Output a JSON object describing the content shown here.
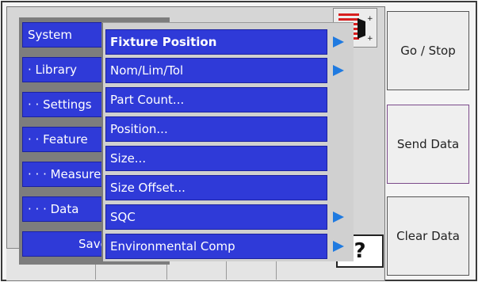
{
  "menu_level1": {
    "items": [
      {
        "label": "System"
      },
      {
        "label": "· Library"
      },
      {
        "label": "· · Settings"
      },
      {
        "label": "· · Feature"
      },
      {
        "label": "· · · Measurements"
      },
      {
        "label": "· · · Data"
      },
      {
        "label": "Save"
      }
    ]
  },
  "menu_level2": {
    "items": [
      {
        "label": "Fixture Position",
        "has_submenu": true
      },
      {
        "label": "Nom/Lim/Tol",
        "has_submenu": true
      },
      {
        "label": "Part Count...",
        "has_submenu": false
      },
      {
        "label": "Position...",
        "has_submenu": false
      },
      {
        "label": "Size...",
        "has_submenu": false
      },
      {
        "label": "Size Offset...",
        "has_submenu": false
      },
      {
        "label": "SQC",
        "has_submenu": true
      },
      {
        "label": "Environmental Comp",
        "has_submenu": true
      }
    ]
  },
  "side_buttons": {
    "go_stop": "Go / Stop",
    "send_data": "Send Data",
    "clear_data": "Clear Data"
  },
  "help": {
    "glyph": "?"
  },
  "colors": {
    "menu_item": "#2f3ad8",
    "arrow": "#1f7ae0",
    "probe_red": "#d81e1e"
  }
}
